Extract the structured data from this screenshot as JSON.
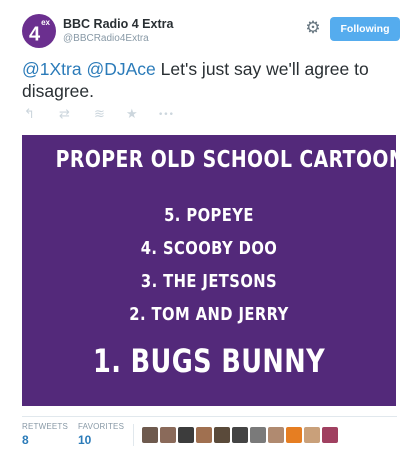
{
  "account": {
    "name": "BBC Radio 4 Extra",
    "handle": "@BBCRadio4Extra",
    "avatar_text": "4",
    "avatar_sup": "ex",
    "avatar_color": "#6b2f8f"
  },
  "follow_button": {
    "label": "Following",
    "color": "#55acee"
  },
  "tweet": {
    "mention1": "@1Xtra",
    "mention2": "@DJAce",
    "text": "Let's just say we'll agree to disagree."
  },
  "actions": [
    {
      "icon": "reply-icon",
      "glyph": "↰"
    },
    {
      "icon": "retweet-icon",
      "glyph": "⇄"
    },
    {
      "icon": "buffer-icon",
      "glyph": "≋"
    },
    {
      "icon": "favorite-icon",
      "glyph": "★"
    },
    {
      "icon": "more-icon",
      "glyph": "•••"
    }
  ],
  "media": {
    "background": "#53297a",
    "title": "PROPER OLD SCHOOL CARTOONS",
    "items": [
      "5.  POPEYE",
      "4.  SCOOBY DOO",
      "3.  THE JETSONS",
      "2.  TOM AND JERRY"
    ],
    "top_item": "1. BUGS BUNNY"
  },
  "stats": {
    "retweets_label": "RETWEETS",
    "retweets_value": "8",
    "favorites_label": "FAVORITES",
    "favorites_value": "10"
  },
  "favoriter_avatars": [
    "#6e5a4e",
    "#8a6a5a",
    "#3c3c3c",
    "#a07050",
    "#5a4a3a",
    "#444444",
    "#7a7a7a",
    "#b08a70",
    "#e67e22",
    "#c9a07a",
    "#a04060"
  ]
}
